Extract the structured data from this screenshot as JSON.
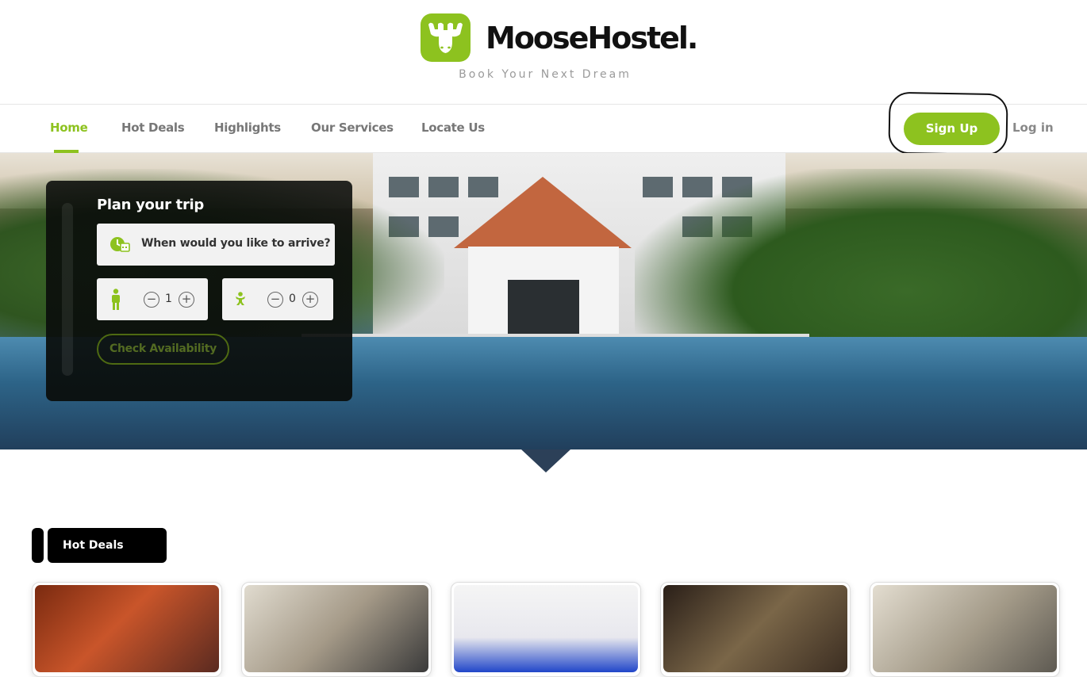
{
  "brand": {
    "name": "MooseHostel.",
    "tagline": "Book Your Next Dream",
    "logo_icon": "moose-icon",
    "accent_color": "#8dc21f"
  },
  "nav": {
    "items": [
      {
        "label": "Home",
        "active": true
      },
      {
        "label": "Hot Deals",
        "active": false
      },
      {
        "label": "Highlights",
        "active": false
      },
      {
        "label": "Our Services",
        "active": false
      },
      {
        "label": "Locate Us",
        "active": false
      }
    ],
    "signup_label": "Sign Up",
    "login_label": "Log in"
  },
  "booking": {
    "title": "Plan your trip",
    "arrival_placeholder": "When would you like to arrive?",
    "arrival_icon": "clock-calendar-icon",
    "adults": {
      "icon": "adult-icon",
      "value": "1"
    },
    "children": {
      "icon": "child-icon",
      "value": "0"
    },
    "check_label": "Check Availability"
  },
  "hot_deals": {
    "heading": "Hot Deals",
    "cards": [
      {
        "name": "deal-card-1",
        "colors": [
          "#8b2f14",
          "#c1552a"
        ]
      },
      {
        "name": "deal-card-2",
        "colors": [
          "#d9d4c8",
          "#6d6458"
        ]
      },
      {
        "name": "deal-card-3",
        "colors": [
          "#f3f3f3",
          "#c9cfe0"
        ]
      },
      {
        "name": "deal-card-4",
        "colors": [
          "#3a2a1e",
          "#6e5a45"
        ]
      },
      {
        "name": "deal-card-5",
        "colors": [
          "#d7d0c2",
          "#8b806f"
        ]
      }
    ]
  }
}
